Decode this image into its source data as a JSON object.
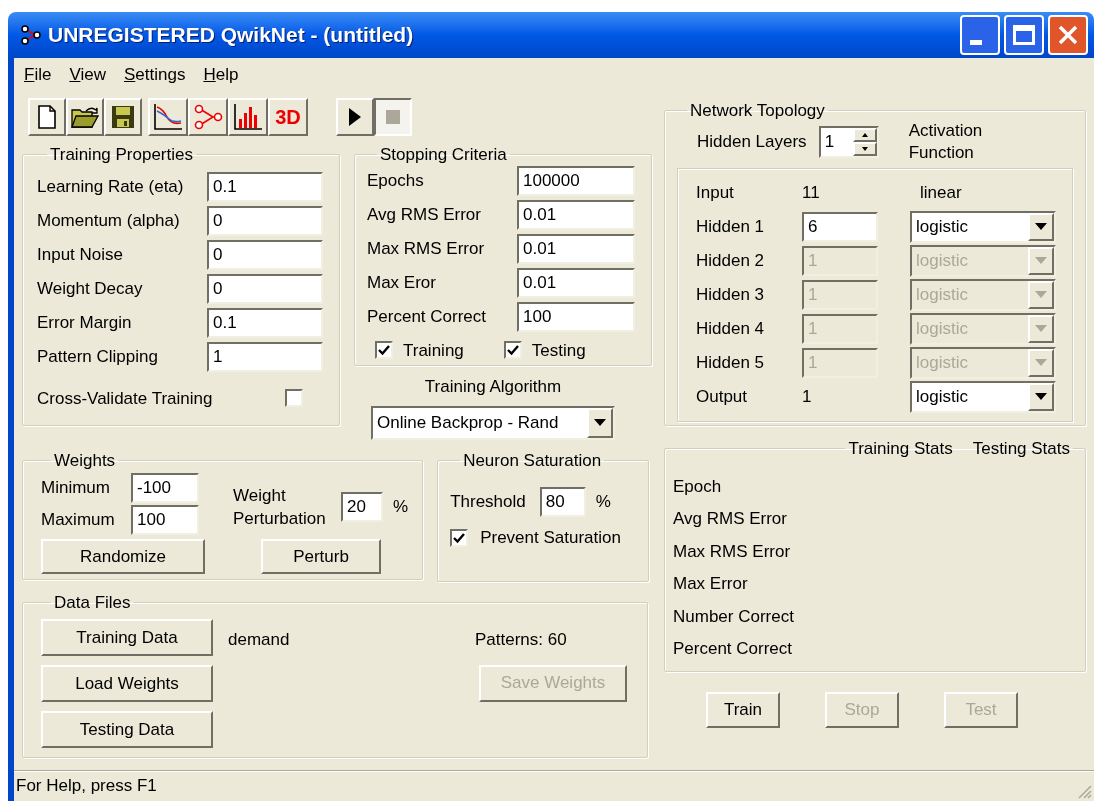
{
  "window": {
    "title": "UNREGISTERED QwikNet - (untitled)"
  },
  "menu": [
    {
      "label": "File"
    },
    {
      "label": "View"
    },
    {
      "label": "Settings"
    },
    {
      "label": "Help"
    }
  ],
  "toolbar": [
    {
      "kind": "new"
    },
    {
      "kind": "open"
    },
    {
      "kind": "save"
    },
    {
      "kind": "graph"
    },
    {
      "kind": "network"
    },
    {
      "kind": "histogram"
    },
    {
      "kind": "threed",
      "label": "3D"
    }
  ],
  "run_controls": [
    {
      "kind": "play",
      "pressed": false
    },
    {
      "kind": "stop",
      "pressed": true
    }
  ],
  "training_properties": {
    "title": "Training Properties",
    "fields": [
      {
        "label": "Learning Rate (eta)",
        "value": "0.1"
      },
      {
        "label": "Momentum (alpha)",
        "value": "0"
      },
      {
        "label": "Input Noise",
        "value": "0"
      },
      {
        "label": "Weight Decay",
        "value": "0"
      },
      {
        "label": "Error Margin",
        "value": "0.1"
      },
      {
        "label": "Pattern Clipping",
        "value": "1"
      }
    ],
    "cross_validate": {
      "label": "Cross-Validate Training",
      "checked": false
    }
  },
  "stopping_criteria": {
    "title": "Stopping Criteria",
    "fields": [
      {
        "label": "Epochs",
        "value": "100000"
      },
      {
        "label": "Avg RMS Error",
        "value": "0.01"
      },
      {
        "label": "Max RMS Error",
        "value": "0.01"
      },
      {
        "label": "Max Eror",
        "value": "0.01"
      },
      {
        "label": "Percent Correct",
        "value": "100"
      }
    ],
    "checks": [
      {
        "label": "Training",
        "checked": true
      },
      {
        "label": "Testing",
        "checked": true
      }
    ]
  },
  "training_algorithm": {
    "label": "Training Algorithm",
    "value": "Online Backprop - Rand"
  },
  "weights": {
    "title": "Weights",
    "minimum": {
      "label": "Minimum",
      "value": "-100"
    },
    "maximum": {
      "label": "Maximum",
      "value": "100"
    },
    "perturbation": {
      "label": "Weight Perturbation",
      "value": "20",
      "unit": "%"
    },
    "buttons": [
      {
        "label": "Randomize"
      },
      {
        "label": "Perturb"
      }
    ]
  },
  "neuron_saturation": {
    "title": "Neuron Saturation",
    "threshold": {
      "label": "Threshold",
      "value": "80",
      "unit": "%"
    },
    "prevent": {
      "label": "Prevent Saturation",
      "checked": true
    }
  },
  "data_files": {
    "title": "Data Files",
    "buttons": [
      {
        "label": "Training Data"
      },
      {
        "label": "Load Weights"
      },
      {
        "label": "Testing Data"
      }
    ],
    "training_file": "demand",
    "patterns": "Patterns: 60",
    "save_button": {
      "label": "Save Weights",
      "disabled": true
    }
  },
  "network_topology": {
    "title": "Network Topology",
    "hidden_layers": {
      "label": "Hidden Layers",
      "value": "1"
    },
    "activation_header": "Activation Function",
    "layers": [
      {
        "kind": "fixed",
        "label": "Input",
        "count": "11",
        "activation": "linear",
        "disabled": false
      },
      {
        "kind": "hidden",
        "label": "Hidden 1",
        "count": "6",
        "activation": "logistic",
        "disabled": false
      },
      {
        "kind": "hidden",
        "label": "Hidden 2",
        "count": "1",
        "activation": "logistic",
        "disabled": true
      },
      {
        "kind": "hidden",
        "label": "Hidden 3",
        "count": "1",
        "activation": "logistic",
        "disabled": true
      },
      {
        "kind": "hidden",
        "label": "Hidden 4",
        "count": "1",
        "activation": "logistic",
        "disabled": true
      },
      {
        "kind": "hidden",
        "label": "Hidden 5",
        "count": "1",
        "activation": "logistic",
        "disabled": true
      },
      {
        "kind": "output",
        "label": "Output",
        "count": "1",
        "activation": "logistic",
        "disabled": false
      }
    ]
  },
  "stats": {
    "headers": [
      "Training Stats",
      "Testing Stats"
    ],
    "rows": [
      "Epoch",
      "Avg RMS Error",
      "Max RMS Error",
      "Max Error",
      "Number Correct",
      "Percent Correct"
    ]
  },
  "actions": [
    {
      "label": "Train",
      "disabled": false
    },
    {
      "label": "Stop",
      "disabled": true
    },
    {
      "label": "Test",
      "disabled": true
    }
  ],
  "status_bar": {
    "text": "For Help, press F1"
  }
}
